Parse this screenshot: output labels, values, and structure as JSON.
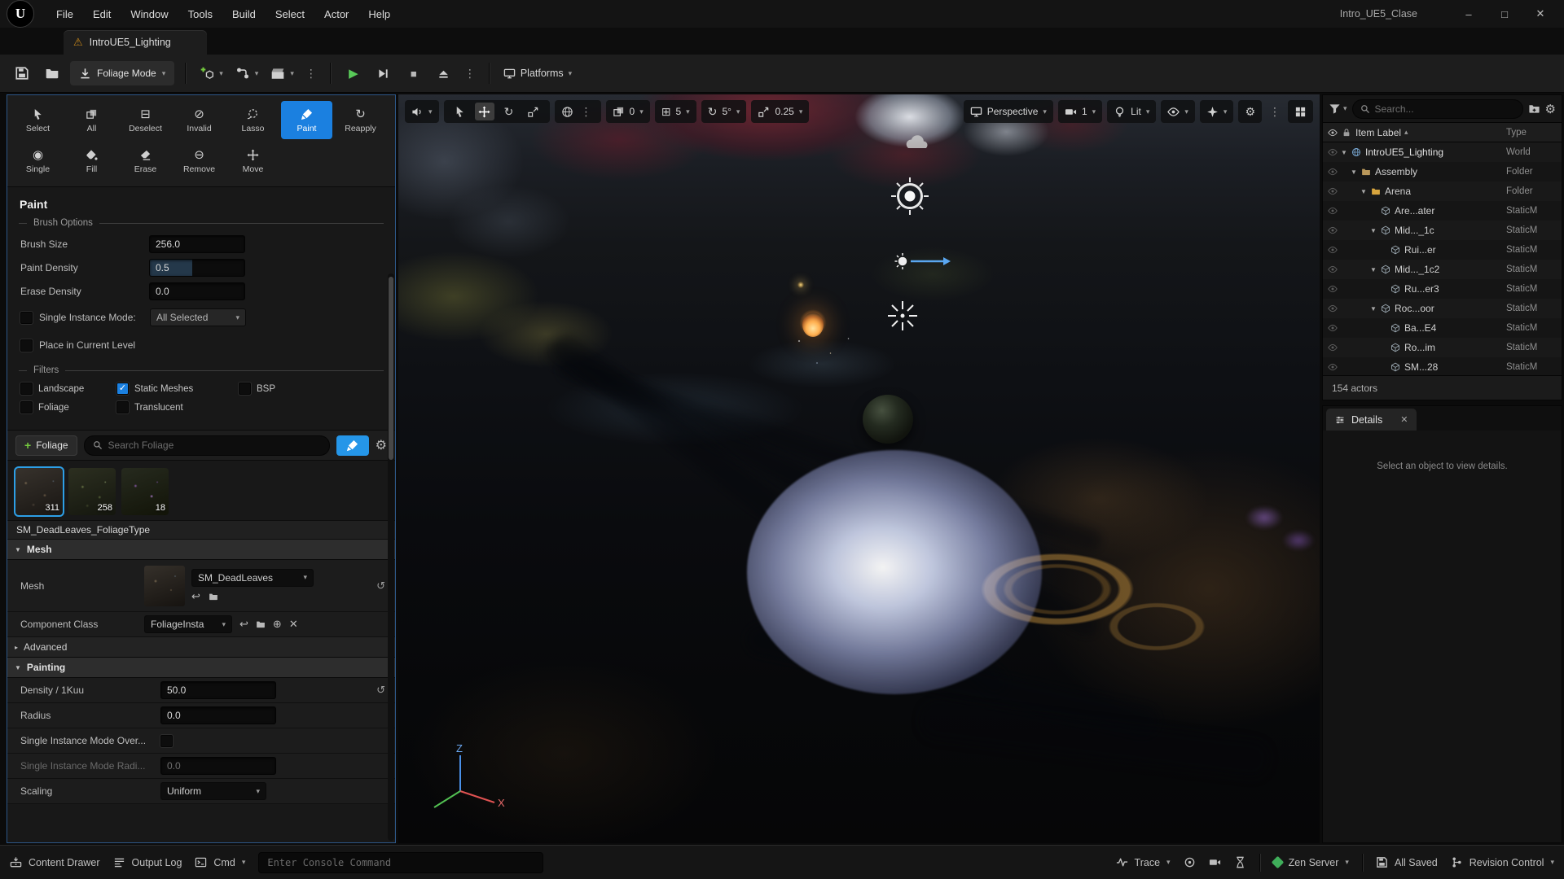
{
  "window": {
    "title": "Intro_UE5_Clase"
  },
  "menubar": {
    "items": [
      "File",
      "Edit",
      "Window",
      "Tools",
      "Build",
      "Select",
      "Actor",
      "Help"
    ],
    "logo": "U"
  },
  "tab": {
    "label": "IntroUE5_Lighting"
  },
  "toolbar": {
    "mode": "Foliage Mode",
    "platforms": "Platforms"
  },
  "foliage": {
    "tools": [
      "Select",
      "All",
      "Deselect",
      "Invalid",
      "Lasso",
      "Paint",
      "Reapply",
      "Single",
      "Fill",
      "Erase",
      "Remove",
      "Move"
    ],
    "title": "Paint",
    "brush_options": "Brush Options",
    "brush_size": {
      "label": "Brush Size",
      "value": "256.0"
    },
    "paint_density": {
      "label": "Paint Density",
      "value": "0.5"
    },
    "erase_density": {
      "label": "Erase Density",
      "value": "0.0"
    },
    "single_instance": {
      "label": "Single Instance Mode:",
      "value": "All Selected"
    },
    "place_level": "Place in Current Level",
    "filters_label": "Filters",
    "filters": [
      {
        "label": "Landscape",
        "checked": false
      },
      {
        "label": "Static Meshes",
        "checked": true
      },
      {
        "label": "BSP",
        "checked": false
      },
      {
        "label": "Foliage",
        "checked": false
      },
      {
        "label": "Translucent",
        "checked": false
      }
    ],
    "add_foliage": "Foliage",
    "search_placeholder": "Search Foliage",
    "thumbs": [
      {
        "count": "311"
      },
      {
        "count": "258"
      },
      {
        "count": "18"
      }
    ],
    "type_name": "SM_DeadLeaves_FoliageType",
    "mesh_section": "Mesh",
    "mesh": {
      "label": "Mesh",
      "value": "SM_DeadLeaves"
    },
    "component": {
      "label": "Component Class",
      "value": "FoliageInsta"
    },
    "advanced": "Advanced",
    "painting_section": "Painting",
    "density": {
      "label": "Density / 1Kuu",
      "value": "50.0"
    },
    "radius": {
      "label": "Radius",
      "value": "0.0"
    },
    "sim_override": "Single Instance Mode Over...",
    "sim_radius": {
      "label": "Single Instance Mode Radi...",
      "value": "0.0"
    },
    "scaling": {
      "label": "Scaling",
      "value": "Uniform"
    }
  },
  "viewport": {
    "snap_surface": "0",
    "snap_grid": "5",
    "snap_rot": "5°",
    "snap_scale": "0.25",
    "perspective": "Perspective",
    "cam_speed": "1",
    "lit": "Lit",
    "axis": {
      "x": "X",
      "z": "Z"
    }
  },
  "outliner": {
    "search_placeholder": "Search...",
    "col_label": "Item Label",
    "col_type": "Type",
    "rows": [
      {
        "label": "IntroUE5_Lighting",
        "type": "World"
      },
      {
        "label": "Assembly",
        "type": "Folder"
      },
      {
        "label": "Arena",
        "type": "Folder"
      },
      {
        "label": "Are...ater",
        "type": "StaticM"
      },
      {
        "label": "Mid..._1c",
        "type": "StaticM"
      },
      {
        "label": "Rui...er",
        "type": "StaticM"
      },
      {
        "label": "Mid..._1c2",
        "type": "StaticM"
      },
      {
        "label": "Ru...er3",
        "type": "StaticM"
      },
      {
        "label": "Roc...oor",
        "type": "StaticM"
      },
      {
        "label": "Ba...E4",
        "type": "StaticM"
      },
      {
        "label": "Ro...im",
        "type": "StaticM"
      },
      {
        "label": "SM...28",
        "type": "StaticM"
      }
    ],
    "status": "154 actors"
  },
  "details": {
    "title": "Details",
    "empty": "Select an object to view details."
  },
  "statusbar": {
    "content_drawer": "Content Drawer",
    "output_log": "Output Log",
    "cmd": "Cmd",
    "console_placeholder": "Enter Console Command",
    "trace": "Trace",
    "zen": "Zen Server",
    "saved": "All Saved",
    "revision": "Revision Control"
  },
  "icons": {
    "chevron_down": "▾",
    "chevron_right": "▸",
    "expand_down": "▼",
    "sort_asc": "▴",
    "dots": "⋮",
    "gear": "⚙",
    "warning": "⚠",
    "check": "✓",
    "close": "✕",
    "minimize": "–",
    "maximize": "□",
    "play": "▶",
    "stop": "■",
    "plus": "+",
    "grid": "⊞",
    "rotate": "↻",
    "reset": "↺",
    "back_arrow": "↩",
    "deselect": "⊟",
    "invalid": "⊘",
    "single": "◉",
    "remove": "⊖",
    "circle_plus": "⊕"
  },
  "colors": {
    "accent": "#1b80e0",
    "warning": "#c8881a",
    "play_green": "#58c958"
  }
}
